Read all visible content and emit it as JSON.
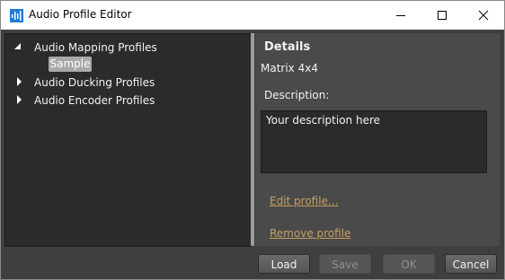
{
  "window": {
    "title": "Audio Profile Editor"
  },
  "tree": {
    "items": [
      {
        "label": "Audio Mapping Profiles",
        "expanded": true,
        "children": [
          {
            "label": "Sample",
            "selected": true
          }
        ]
      },
      {
        "label": "Audio Ducking Profiles",
        "expanded": false
      },
      {
        "label": "Audio Encoder Profiles",
        "expanded": false
      }
    ]
  },
  "details": {
    "title": "Details",
    "profile_name": "Matrix 4x4",
    "description_label": "Description:",
    "description_value": "Your description here",
    "edit_link": "Edit profile...",
    "remove_link": "Remove profile"
  },
  "buttons": {
    "load": "Load",
    "save": "Save",
    "ok": "OK",
    "cancel": "Cancel"
  },
  "colors": {
    "panel_dark": "#2b2b2b",
    "panel_mid": "#4a4a4a",
    "background": "#3f3f3f",
    "link": "#c8a060",
    "selection": "#a9a9a9"
  }
}
